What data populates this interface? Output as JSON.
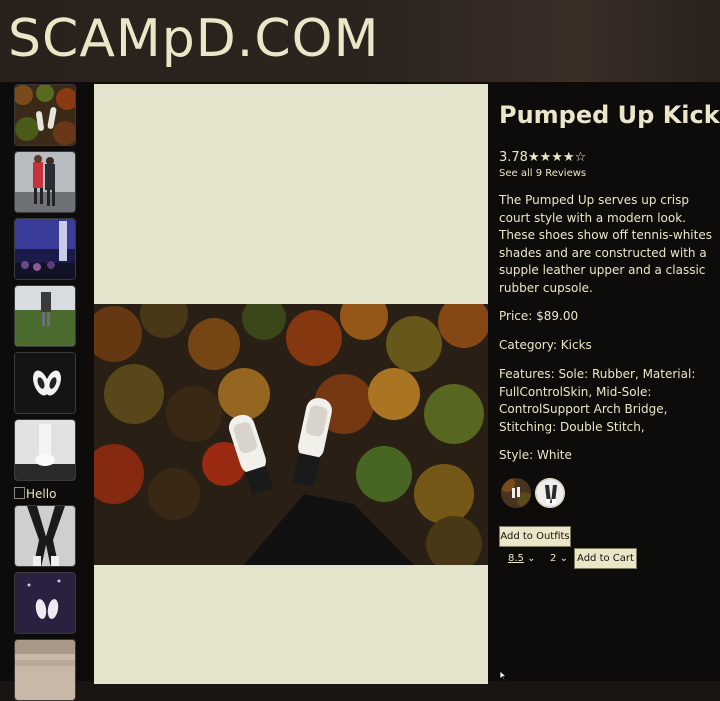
{
  "header": {
    "logo": "SCAMpD.COM"
  },
  "thumbnails": [
    {
      "alt": "",
      "kind": "forest"
    },
    {
      "alt": "",
      "kind": "street"
    },
    {
      "alt": "",
      "kind": "concert"
    },
    {
      "alt": "",
      "kind": "field"
    },
    {
      "alt": "",
      "kind": "shoes-dark"
    },
    {
      "alt": "",
      "kind": "shoes-light"
    },
    {
      "alt": "Hello",
      "kind": "broken"
    },
    {
      "alt": "",
      "kind": "legs"
    },
    {
      "alt": "",
      "kind": "purple"
    },
    {
      "alt": "",
      "kind": "sand"
    }
  ],
  "product": {
    "title": "Pumped Up Kicks",
    "rating_value": "3.78",
    "rating_stars": "★★★★☆",
    "rating": 3.78,
    "reviews_link": "See all 9 Reviews",
    "description": "The Pumped Up serves up crisp court style with a modern look. These shoes show off tennis-whites shades and are constructed with a supple leather upper and a classic rubber cupsole.",
    "price": "Price: $89.00",
    "category": "Category: Kicks",
    "features": "Features: Sole: Rubber, Material: FullControlSkin, Mid-Sole: ControlSupport Arch Bridge, Stitching: Double Stitch,",
    "style": "Style: White"
  },
  "actions": {
    "add_to_outfits": "Add to Outfits",
    "size_value": "8.5",
    "quantity_value": "2",
    "add_to_cart": "Add to Cart"
  },
  "colors": {
    "background": "#0e0c0b",
    "text": "#ece6c8",
    "panel": "#e4e4cc",
    "button": "#ece6c8"
  }
}
